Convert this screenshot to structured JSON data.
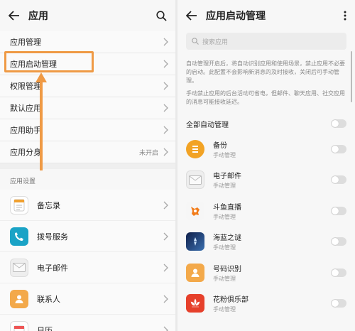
{
  "left": {
    "title": "应用",
    "menu": [
      {
        "label": "应用管理",
        "value": ""
      },
      {
        "label": "应用启动管理",
        "value": ""
      },
      {
        "label": "权限管理",
        "value": ""
      },
      {
        "label": "默认应用",
        "value": ""
      },
      {
        "label": "应用助手",
        "value": ""
      },
      {
        "label": "应用分身",
        "value": "未开启"
      }
    ],
    "section_title": "应用设置",
    "apps": [
      {
        "label": "备忘录",
        "icon": "notes-icon",
        "color": "#ffffff"
      },
      {
        "label": "拨号服务",
        "icon": "phone-icon",
        "color": "#1aa3c6"
      },
      {
        "label": "电子邮件",
        "icon": "email-icon",
        "color": "#eeeeee"
      },
      {
        "label": "联系人",
        "icon": "contacts-icon",
        "color": "#f3a94a"
      },
      {
        "label": "日历",
        "icon": "calendar-icon",
        "color": "#ffffff"
      }
    ]
  },
  "right": {
    "title": "应用启动管理",
    "search_placeholder": "搜索应用",
    "desc1": "自动管理开启后，将自动识别应用和使用场景，禁止应用不必要的启动。此配置不会影响新消息的及时接收，关闭后可手动管理。",
    "desc2": "手动禁止应用的后台活动可省电，但邮件、聊天应用、社交应用的消息可能接收延迟。",
    "all_label": "全部自动管理",
    "apps": [
      {
        "name": "备份",
        "sub": "手动管理",
        "icon": "backup-icon",
        "color": "#f2a325"
      },
      {
        "name": "电子邮件",
        "sub": "手动管理",
        "icon": "email-icon",
        "color": "#e6e6e6"
      },
      {
        "name": "斗鱼直播",
        "sub": "手动管理",
        "icon": "douyu-icon",
        "color": "#f6f6f6"
      },
      {
        "name": "海蓝之谜",
        "sub": "手动管理",
        "icon": "game-icon",
        "color": "#243a6b"
      },
      {
        "name": "号码识别",
        "sub": "手动管理",
        "icon": "caller-id-icon",
        "color": "#f3a94a"
      },
      {
        "name": "花粉俱乐部",
        "sub": "手动管理",
        "icon": "club-icon",
        "color": "#e6402b"
      }
    ]
  }
}
